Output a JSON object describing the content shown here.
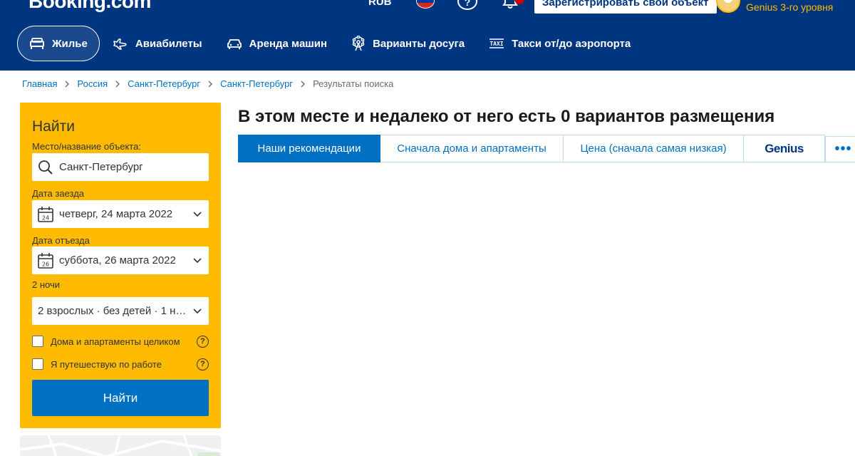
{
  "header": {
    "logo": "Booking.com",
    "currency": "RUB",
    "list_property": "Зарегистрировать свой объект",
    "genius_level": "Genius 3-го уровня",
    "nav": [
      {
        "label": "Жилье",
        "icon": "bed-icon",
        "active": true
      },
      {
        "label": "Авиабилеты",
        "icon": "plane-icon",
        "active": false
      },
      {
        "label": "Аренда машин",
        "icon": "car-icon",
        "active": false
      },
      {
        "label": "Варианты досуга",
        "icon": "attractions-icon",
        "active": false
      },
      {
        "label": "Такси от/до аэропорта",
        "icon": "taxi-icon",
        "active": false
      }
    ]
  },
  "breadcrumb": [
    "Главная",
    "Россия",
    "Санкт-Петербург",
    "Санкт-Петербург",
    "Результаты поиска"
  ],
  "search": {
    "title": "Найти",
    "destination_label": "Место/название объекта:",
    "destination_value": "Санкт-Петербург",
    "checkin_label": "Дата заезда",
    "checkin_day": "24",
    "checkin_value": "четверг, 24 марта 2022",
    "checkout_label": "Дата отъезда",
    "checkout_day": "26",
    "checkout_value": "суббота, 26 марта 2022",
    "nights": "2 ночи",
    "guests_value": "2 взрослых · без детей · 1 но...",
    "entire_homes_label": "Дома и апартаменты целиком",
    "work_travel_label": "Я путешествую по работе",
    "help_symbol": "?",
    "button_label": "Найти"
  },
  "results": {
    "title": "В этом месте и недалеко от него есть 0 вариантов размещения",
    "sort_tabs": [
      "Наши рекомендации",
      "Сначала дома и апартаменты",
      "Цена (сначала самая низкая)",
      "Genius"
    ],
    "more_label": "•••"
  },
  "colors": {
    "brand_dark": "#003580",
    "brand_blue": "#0071c2",
    "search_yellow": "#febb02"
  }
}
